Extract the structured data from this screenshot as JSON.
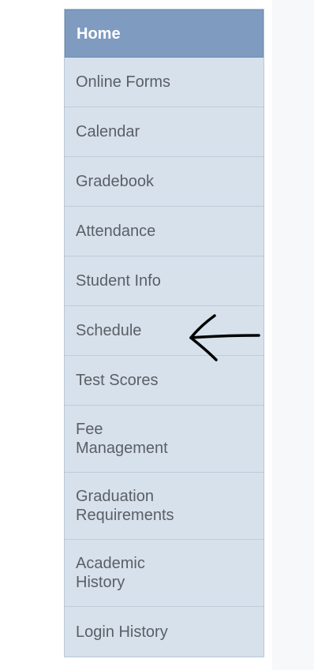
{
  "sidebar": {
    "items": [
      {
        "label": "Home"
      },
      {
        "label": "Online Forms"
      },
      {
        "label": "Calendar"
      },
      {
        "label": "Gradebook"
      },
      {
        "label": "Attendance"
      },
      {
        "label": "Student Info"
      },
      {
        "label": "Schedule"
      },
      {
        "label": "Test Scores"
      },
      {
        "label": "Fee\nManagement"
      },
      {
        "label": "Graduation\nRequirements"
      },
      {
        "label": "Academic\nHistory"
      },
      {
        "label": "Login History"
      }
    ]
  },
  "annotation": {
    "icon": "hand-drawn-arrow-left-icon",
    "color": "#000000"
  },
  "colors": {
    "active_bg": "#7f9bc0",
    "item_bg": "#d7e1eb",
    "text": "#5a5f66"
  }
}
